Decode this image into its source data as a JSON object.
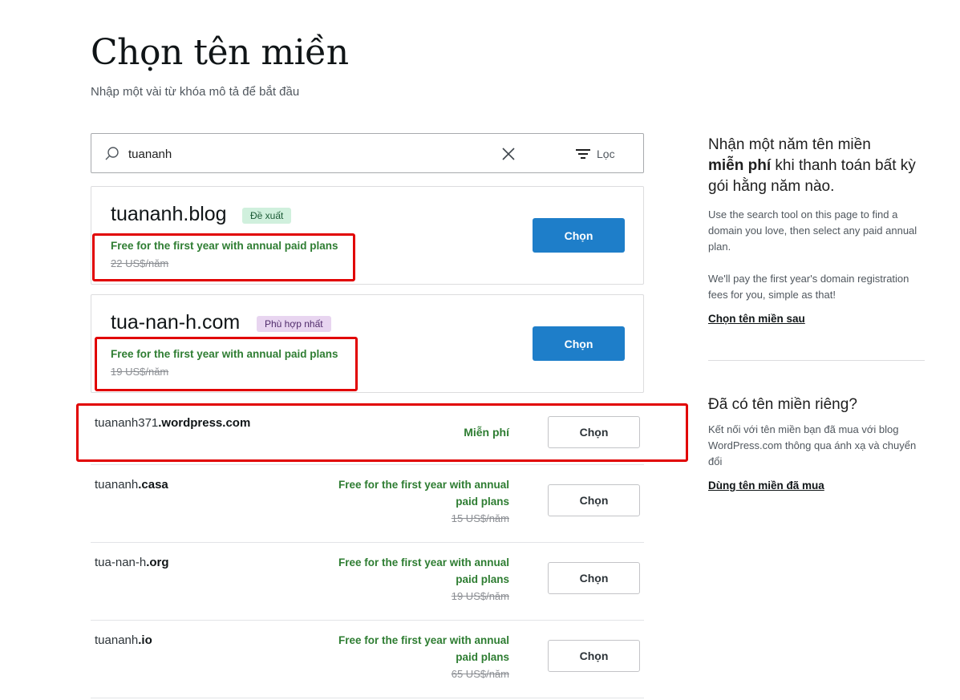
{
  "page": {
    "title": "Chọn tên miền",
    "subtitle": "Nhập một vài từ khóa mô tả để bắt đầu"
  },
  "search": {
    "value": "tuananh",
    "filter_label": "Lọc"
  },
  "featured": [
    {
      "domain": "tuananh.blog",
      "badge": "Đề xuất",
      "promo": "Free for the first year with annual paid plans",
      "old_price": "22 US$/năm",
      "button": "Chọn"
    },
    {
      "domain": "tua-nan-h.com",
      "badge": "Phù hợp nhất",
      "promo": "Free for the first year with annual paid plans",
      "old_price": "19 US$/năm",
      "button": "Chọn"
    }
  ],
  "free_row": {
    "domain_prefix": "tuananh371",
    "domain_suffix": ".wordpress.com",
    "price": "Miễn phí",
    "button": "Chọn"
  },
  "results": [
    {
      "prefix": "tuananh",
      "tld": ".casa",
      "promo_line1": "Free for the first year with annual",
      "promo_line2": "paid plans",
      "old_price": "15 US$/năm",
      "button": "Chọn"
    },
    {
      "prefix": "tua-nan-h",
      "tld": ".org",
      "promo_line1": "Free for the first year with annual",
      "promo_line2": "paid plans",
      "old_price": "19 US$/năm",
      "button": "Chọn"
    },
    {
      "prefix": "tuananh",
      "tld": ".io",
      "promo_line1": "Free for the first year with annual",
      "promo_line2": "paid plans",
      "old_price": "65 US$/năm",
      "button": "Chọn"
    }
  ],
  "sidebar": {
    "offer_heading_1": "Nhận một năm tên miền",
    "offer_heading_bold": "miễn phí",
    "offer_heading_2": "khi thanh toán bất kỳ gói hằng năm nào.",
    "offer_text_1": "Use the search tool on this page to find a domain you love, then select any paid annual plan.",
    "offer_text_2": "We'll pay the first year's domain registration fees for you, simple as that!",
    "offer_link": "Chọn tên miền sau",
    "own_heading": "Đã có tên miền riêng?",
    "own_text": "Kết nối với tên miền bạn đã mua với blog WordPress.com thông qua ánh xạ và chuyển đổi",
    "own_link": "Dùng tên miền đã mua"
  },
  "colors": {
    "primary": "#1e7ec9",
    "promo_green": "#2e7d32",
    "highlight_red": "#e10000"
  }
}
